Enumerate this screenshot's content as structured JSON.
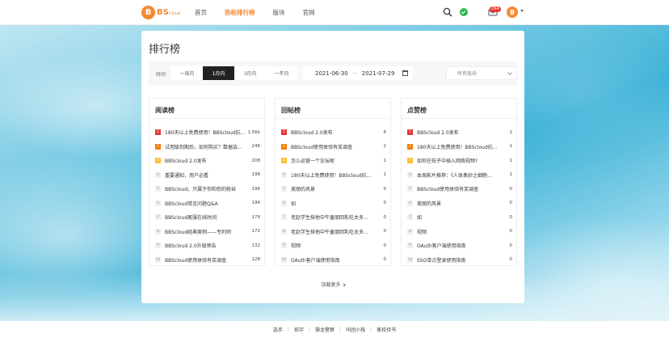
{
  "header": {
    "logo_letter": "B",
    "logo_text": "BS",
    "logo_small": "Cloud",
    "nav": [
      "首页",
      "热帖排行榜",
      "版块",
      "官网"
    ],
    "badge": "294",
    "avatar_letter": "B",
    "accent_color": "#f28a32"
  },
  "page": {
    "title": "排行榜",
    "filter_label": "时间",
    "tabs": [
      "一周内",
      "1月内",
      "3月内",
      "一年内"
    ],
    "active_tab": "1月内",
    "date_start": "2021-06-30",
    "date_sep": "--",
    "date_end": "2021-07-29",
    "board_select": "所有版块",
    "load_more": "加载更多"
  },
  "rankings": [
    {
      "title": "阅读榜",
      "rows": [
        {
          "rank": "1",
          "title": "180天以上免费使用！BBScloud抗...",
          "count": "1.56k"
        },
        {
          "rank": "2",
          "title": "试用版到期后，如何购买？数据会...",
          "count": "246"
        },
        {
          "rank": "3",
          "title": "BBScloud 2.0发布",
          "count": "208"
        },
        {
          "rank": "4",
          "title": "重要通知，用户必看",
          "count": "198"
        },
        {
          "rank": "5",
          "title": "BBScloud，只属于你和你的粉丝",
          "count": "196"
        },
        {
          "rank": "6",
          "title": "BBScloud常见问题Q&A",
          "count": "194"
        },
        {
          "rank": "7",
          "title": "BBScloud客服在线时间",
          "count": "179"
        },
        {
          "rank": "8",
          "title": "BBScloud经典案例——专利师",
          "count": "172"
        },
        {
          "rank": "9",
          "title": "BBScloud 2.0升级预告",
          "count": "132"
        },
        {
          "rank": "10",
          "title": "BBScloud使用体验有奖调查",
          "count": "128"
        }
      ]
    },
    {
      "title": "回帖榜",
      "rows": [
        {
          "rank": "1",
          "title": "BBScloud 2.0发布",
          "count": "6"
        },
        {
          "rank": "2",
          "title": "BBScloud使用体验有奖调查",
          "count": "2"
        },
        {
          "rank": "3",
          "title": "怎么运营一个论坛呢",
          "count": "1"
        },
        {
          "rank": "4",
          "title": "180天以上免费使用！BBScloud抗...",
          "count": "1"
        },
        {
          "rank": "5",
          "title": "美丽的风景",
          "count": "0"
        },
        {
          "rank": "6",
          "title": "如",
          "count": "0"
        },
        {
          "rank": "7",
          "title": "老赵学生抹他中午童朋回乳吃太多...",
          "count": "0"
        },
        {
          "rank": "8",
          "title": "老赵学生抹他中午童朋回乳吃太多...",
          "count": "0"
        },
        {
          "rank": "9",
          "title": "视频",
          "count": "0"
        },
        {
          "rank": "10",
          "title": "OAuth客户端使用指南",
          "count": "0"
        }
      ]
    },
    {
      "title": "点赞榜",
      "rows": [
        {
          "rank": "1",
          "title": "BBScloud 2.0发布",
          "count": "2"
        },
        {
          "rank": "2",
          "title": "180天以上免费使用！BBScloud抗...",
          "count": "1"
        },
        {
          "rank": "3",
          "title": "如何在帖子中插入网络视频?",
          "count": "1"
        },
        {
          "rank": "4",
          "title": "本周影片推荐：《人体奥妙之细胞...",
          "count": "1"
        },
        {
          "rank": "5",
          "title": "BBScloud使用体验有奖调查",
          "count": "0"
        },
        {
          "rank": "6",
          "title": "美丽的风景",
          "count": "0"
        },
        {
          "rank": "7",
          "title": "如",
          "count": "0"
        },
        {
          "rank": "8",
          "title": "视频",
          "count": "0"
        },
        {
          "rank": "9",
          "title": "OAuth客户端使用指南",
          "count": "0"
        },
        {
          "rank": "10",
          "title": "SSO单点登录使用指南",
          "count": "0"
        }
      ]
    }
  ],
  "footer": {
    "links": [
      "选手",
      "拓宇",
      "操龙警察",
      "叫团小栈",
      "客校待书"
    ]
  }
}
